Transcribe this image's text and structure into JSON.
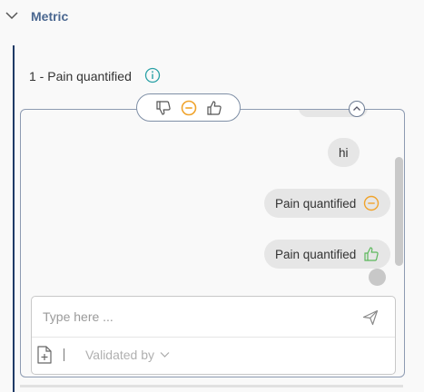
{
  "section": {
    "title": "Metric"
  },
  "metric": {
    "label": "1 - Pain quantified"
  },
  "chat": {
    "messages": [
      {
        "text": "hi",
        "status": ""
      },
      {
        "text": "Pain quantified",
        "status": "neutral-icon"
      },
      {
        "text": "Pain quantified",
        "status": "thumbs-up-icon"
      }
    ]
  },
  "input": {
    "placeholder": "Type here ...",
    "validated_label": "Validated by"
  },
  "colors": {
    "accent_orange": "#f0a32b",
    "accent_green": "#5cb85c",
    "title_blue": "#4a6790",
    "info_teal": "#2aa1a6"
  }
}
